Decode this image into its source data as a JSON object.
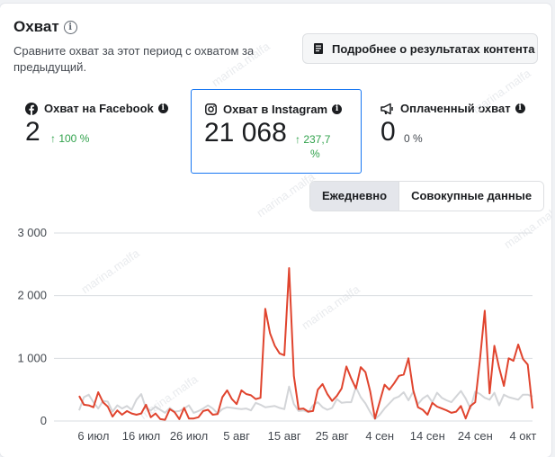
{
  "header": {
    "title": "Охват",
    "subtitle": "Сравните охват за этот период с охватом за предыдущий.",
    "details_button": "Подробнее о результатах контента"
  },
  "metrics": [
    {
      "label": "Охват на Facebook",
      "value": "2",
      "change": "↑ 100 %",
      "icon": "facebook-icon",
      "selected": false
    },
    {
      "label": "Охват в Instagram",
      "value": "21 068",
      "change": "↑ 237,7 %",
      "change_line1": "↑ 237,7",
      "change_line2": "%",
      "icon": "instagram-icon",
      "selected": true
    },
    {
      "label": "Оплаченный охват",
      "value": "0",
      "change": "0 %",
      "icon": "megaphone-icon",
      "selected": false
    }
  ],
  "toggle": {
    "daily": "Ежедневно",
    "cumulative": "Совокупные данные",
    "active": "daily"
  },
  "watermark": "marina.malfa",
  "colors": {
    "instagram_series": "#e0442e",
    "previous_series": "#d3d5d8",
    "accent": "#1877f2",
    "positive": "#31a24c"
  },
  "chart_data": {
    "type": "line",
    "ylim": [
      0,
      3000
    ],
    "yticks": [
      "3 000",
      "2 000",
      "1 000",
      "0"
    ],
    "ytick_values": [
      3000,
      2000,
      1000,
      0
    ],
    "xticks": [
      "6 июл",
      "16 июл",
      "26 июл",
      "5 авг",
      "15 авг",
      "25 авг",
      "4 сен",
      "14 сен",
      "24 сен",
      "4 окт"
    ],
    "series": [
      {
        "values": [
          400,
          260,
          250,
          220,
          460,
          300,
          230,
          70,
          170,
          100,
          160,
          120,
          100,
          120,
          260,
          60,
          120,
          30,
          20,
          190,
          140,
          30,
          210,
          40,
          40,
          60,
          160,
          180,
          100,
          110,
          380,
          490,
          350,
          270,
          490,
          430,
          410,
          350,
          370,
          1790,
          1400,
          1200,
          1080,
          1050,
          2440,
          720,
          190,
          200,
          150,
          160,
          500,
          590,
          430,
          320,
          400,
          520,
          870,
          680,
          520,
          860,
          780,
          470,
          40,
          310,
          580,
          500,
          600,
          720,
          740,
          1000,
          490,
          220,
          180,
          100,
          290,
          230,
          200,
          170,
          130,
          150,
          240,
          40,
          240,
          300,
          980,
          1760,
          440,
          1200,
          850,
          560,
          1000,
          960,
          1220,
          990,
          900,
          200
        ]
      },
      {
        "values": [
          170,
          380,
          420,
          300,
          200,
          320,
          310,
          150,
          250,
          200,
          240,
          180,
          340,
          430,
          200,
          170,
          230,
          180,
          130,
          210,
          150,
          160,
          200,
          250,
          130,
          160,
          200,
          250,
          200,
          120,
          190,
          220,
          210,
          200,
          190,
          200,
          170,
          290,
          260,
          220,
          230,
          240,
          210,
          190,
          550,
          270,
          160,
          170,
          140,
          250,
          300,
          220,
          180,
          210,
          350,
          290,
          300,
          300,
          540,
          380,
          280,
          140,
          30,
          100,
          200,
          280,
          360,
          390,
          460,
          330,
          470,
          270,
          360,
          410,
          300,
          450,
          370,
          330,
          300,
          390,
          480,
          360,
          200,
          470,
          430,
          370,
          340,
          450,
          250,
          420,
          380,
          360,
          340,
          420,
          420,
          390
        ]
      }
    ]
  }
}
